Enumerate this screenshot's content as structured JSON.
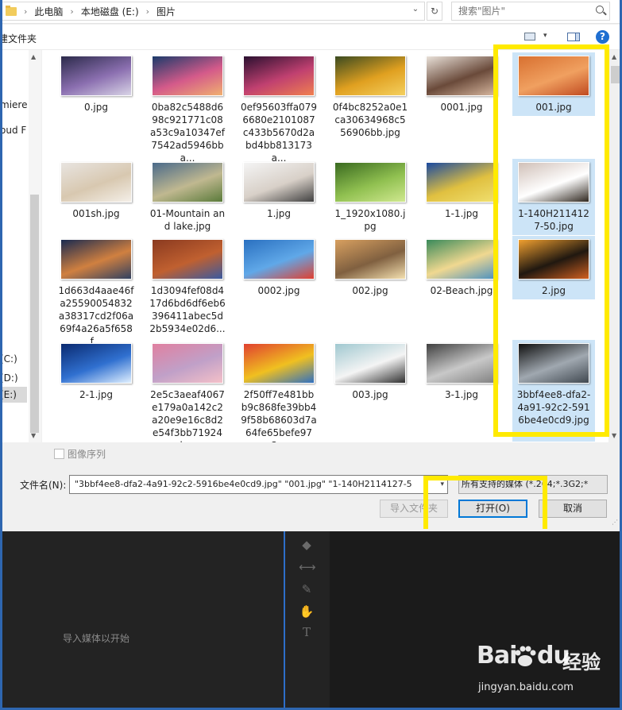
{
  "address": {
    "crumbs": [
      "此电脑",
      "本地磁盘 (E:)",
      "图片"
    ]
  },
  "search": {
    "placeholder": "搜索\"图片\""
  },
  "toolbar": {
    "new_folder": "建文件夹",
    "help": "?"
  },
  "nav": {
    "items": [
      "miere",
      "oud F",
      "(C:)",
      "(D:)",
      "(E:)"
    ]
  },
  "files": [
    {
      "name": "0.jpg",
      "thumb": [
        "#2b2a4a",
        "#8b6fb0",
        "#d9d4e6"
      ]
    },
    {
      "name": "0ba82c5488d698c921771c08a53c9a10347ef7542ad5946bba...",
      "thumb": [
        "#1a3a6a",
        "#d45a8a",
        "#f0b070"
      ]
    },
    {
      "name": "0ef95603ffa0796680e2101087c433b5670d2abd4bb813173a...",
      "thumb": [
        "#2a1030",
        "#c04070",
        "#f08050"
      ]
    },
    {
      "name": "0f4bc8252a0e1ca30634968c556906bb.jpg",
      "thumb": [
        "#3a4a20",
        "#e0a020",
        "#f4d060"
      ]
    },
    {
      "name": "0001.jpg",
      "thumb": [
        "#e8e0d8",
        "#6a4a3a",
        "#d8b8a0"
      ]
    },
    {
      "name": "001.jpg",
      "thumb": [
        "#d87030",
        "#f0a060",
        "#c04a20"
      ],
      "selected": true
    },
    {
      "name": "001sh.jpg",
      "thumb": [
        "#e8e4e0",
        "#d8c8b0",
        "#f4efe8"
      ]
    },
    {
      "name": "01-Mountain and lake.jpg",
      "thumb": [
        "#4a6a8a",
        "#c0b890",
        "#5a7a3a"
      ]
    },
    {
      "name": "1.jpg",
      "thumb": [
        "#f4f4f4",
        "#d8d0c8",
        "#404040"
      ]
    },
    {
      "name": "1_1920x1080.jpg",
      "thumb": [
        "#3a6a20",
        "#90c050",
        "#d0e890"
      ]
    },
    {
      "name": "1-1.jpg",
      "thumb": [
        "#1a4aa0",
        "#e0c040",
        "#f0e070"
      ]
    },
    {
      "name": "1-140H2114127-50.jpg",
      "thumb": [
        "#d0c0b8",
        "#ffffff",
        "#302820"
      ],
      "selected": true
    },
    {
      "name": "1d663d4aae46fa25590054832a38317cd2f06a69f4a26a5f658f...",
      "thumb": [
        "#1a2a50",
        "#d08040",
        "#304060"
      ]
    },
    {
      "name": "1d3094fef08d417d6bd6df6eb6396411abec5d2b5934e02d6...",
      "thumb": [
        "#8a3a20",
        "#c06030",
        "#3a5aa0"
      ]
    },
    {
      "name": "0002.jpg",
      "thumb": [
        "#2a70c0",
        "#60a8e8",
        "#e04030"
      ]
    },
    {
      "name": "002.jpg",
      "thumb": [
        "#d8a060",
        "#806040",
        "#f4e0b0"
      ]
    },
    {
      "name": "02-Beach.jpg",
      "thumb": [
        "#3a8a5a",
        "#f0d890",
        "#4a90c0"
      ]
    },
    {
      "name": "2.jpg",
      "thumb": [
        "#f0a030",
        "#201810",
        "#d06020"
      ],
      "selected": true
    },
    {
      "name": "2-1.jpg",
      "thumb": [
        "#0a2a70",
        "#3070d0",
        "#e0f0ff"
      ]
    },
    {
      "name": "2e5c3aeaf4067e179a0a142c2a20e9e16c8d2e54f3bb71924b...",
      "thumb": [
        "#e080a0",
        "#c0a0c8",
        "#f4c0c8"
      ]
    },
    {
      "name": "2f50ff7e481bbb9c868fe39bb49f58b68603d7a64fe65befe973...",
      "thumb": [
        "#e04030",
        "#f0c020",
        "#3070c0"
      ]
    },
    {
      "name": "003.jpg",
      "thumb": [
        "#a0c8d0",
        "#f4f4f4",
        "#303030"
      ]
    },
    {
      "name": "3-1.jpg",
      "thumb": [
        "#404040",
        "#c8c8c8",
        "#808080"
      ]
    },
    {
      "name": "3bbf4ee8-dfa2-4a91-92c2-5916be4e0cd9.jpg",
      "thumb": [
        "#101010",
        "#a0a8b0",
        "#404850"
      ],
      "selected": true
    }
  ],
  "form": {
    "sequence_label": "图像序列",
    "filename_label": "文件名(N):",
    "filename_value": "\"3bbf4ee8-dfa2-4a91-92c2-5916be4e0cd9.jpg\" \"001.jpg\" \"1-140H2114127-5",
    "filetype_value": "所有支持的媒体 (*.264;*.3G2;*",
    "import_folder": "导入文件夹",
    "open": "打开(O)",
    "cancel": "取消"
  },
  "premiere": {
    "hint": "导入媒体以开始"
  },
  "watermark": {
    "brand": "Bai",
    "brand2": "经验",
    "url": "jingyan.baidu.com"
  },
  "colors": {
    "highlight": "#ffea00",
    "selection": "#cce4f7",
    "accent": "#0078d7"
  }
}
